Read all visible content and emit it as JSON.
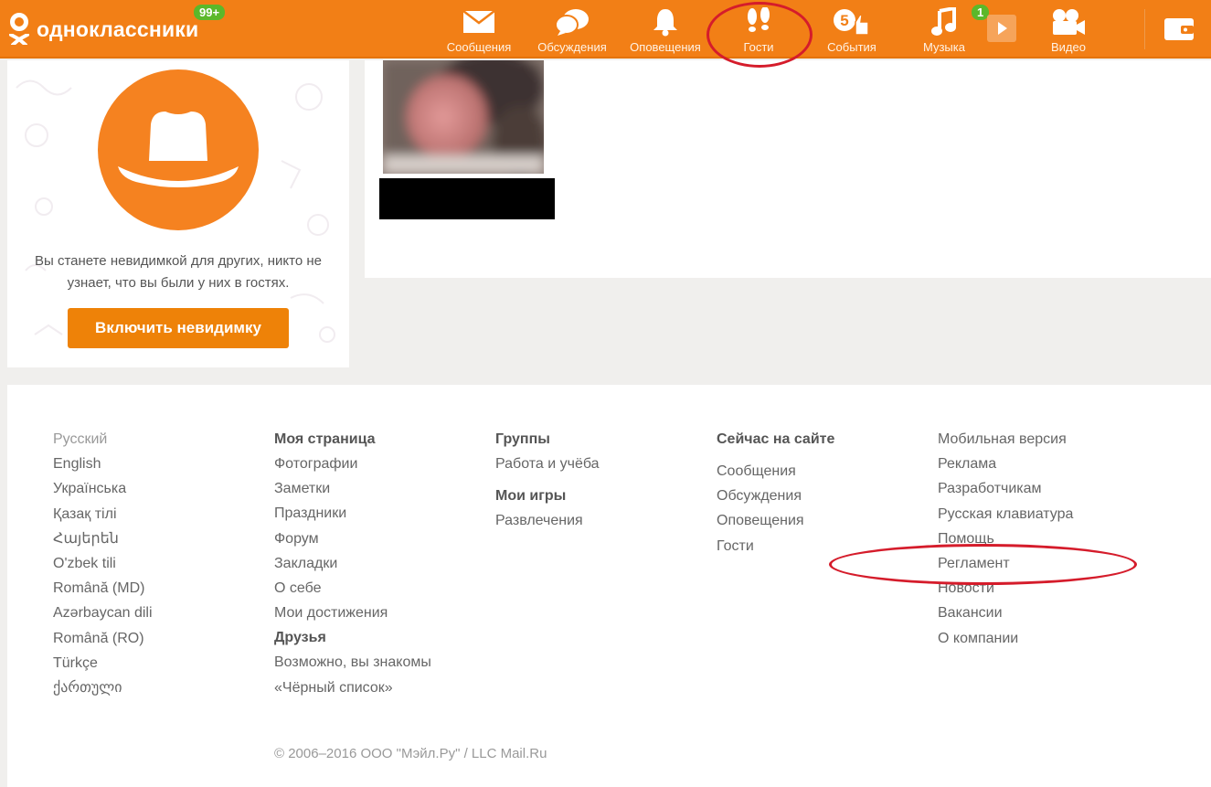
{
  "header": {
    "logo_text": "одноклассники",
    "notifications_badge": "99+",
    "music_badge": "1",
    "nav": [
      {
        "label": "Сообщения",
        "icon": "envelope-icon"
      },
      {
        "label": "Обсуждения",
        "icon": "chat-bubbles-icon"
      },
      {
        "label": "Оповещения",
        "icon": "bell-icon"
      },
      {
        "label": "Гости",
        "icon": "footprints-icon"
      },
      {
        "label": "События",
        "icon": "coin-like-icon"
      },
      {
        "label": "Музыка",
        "icon": "music-note-icon"
      },
      {
        "label": "Видео",
        "icon": "video-camera-icon"
      }
    ],
    "accent_color": "#f27f16"
  },
  "invisible": {
    "text": "Вы станете невидимкой для других, никто не узнает, что вы были у них в гостях.",
    "button_label": "Включить невидимку"
  },
  "footer": {
    "languages": {
      "current": "Русский",
      "items": [
        "English",
        "Українська",
        "Қазақ тілі",
        "Հայերեն",
        "O'zbek tili",
        "Română (MD)",
        "Azərbaycan dili",
        "Română (RO)",
        "Türkçe",
        "ქართული"
      ]
    },
    "my_page": {
      "head": "Моя страница",
      "items": [
        "Фотографии",
        "Заметки",
        "Праздники",
        "Форум",
        "Закладки",
        "О себе",
        "Мои достижения"
      ],
      "friends_head": "Друзья",
      "friends_items": [
        "Возможно, вы знакомы",
        "«Чёрный список»"
      ]
    },
    "groups": {
      "head": "Группы",
      "items": [
        "Работа и учёба"
      ],
      "games_head": "Мои игры",
      "games_items": [
        "Развлечения"
      ]
    },
    "online": {
      "head": "Сейчас на сайте",
      "items": [
        "Сообщения",
        "Обсуждения",
        "Оповещения",
        "Гости"
      ]
    },
    "info": {
      "items": [
        "Мобильная версия",
        "Реклама",
        "Разработчикам",
        "Русская клавиатура",
        "Помощь",
        "Регламент",
        "Новости",
        "Вакансии",
        "О компании"
      ]
    },
    "copyright": "© 2006–2016 ООО \"Мэйл.Ру\" / LLC Mail.Ru"
  }
}
